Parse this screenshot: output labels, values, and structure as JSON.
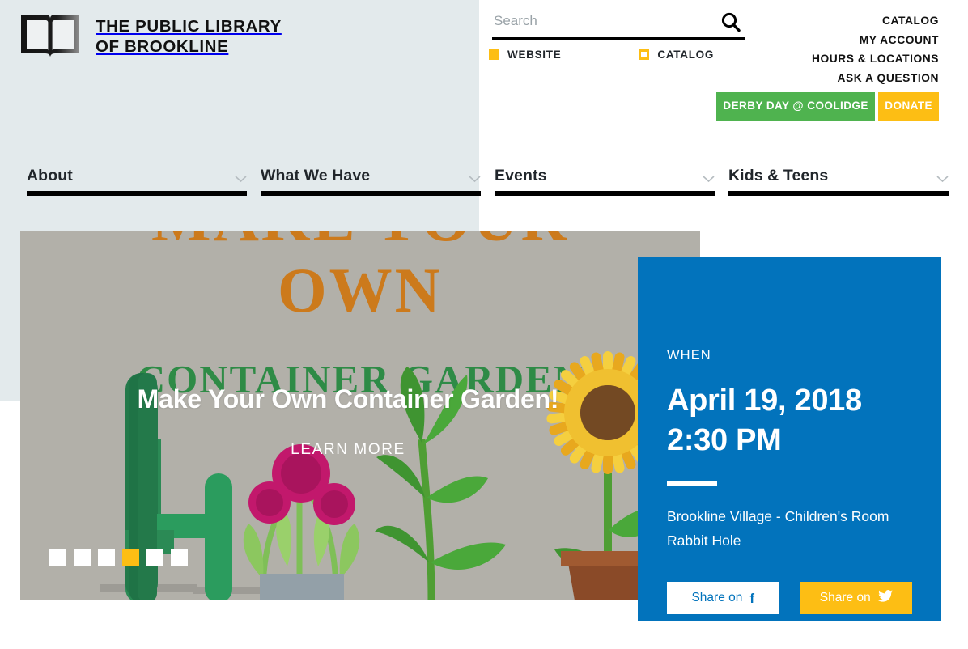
{
  "brand": {
    "name": "THE PUBLIC LIBRARY\nOF BROOKLINE",
    "logo_icon": "open-book-icon"
  },
  "search": {
    "placeholder": "Search",
    "value": "",
    "icon": "search-icon",
    "scopes": [
      {
        "label": "WEBSITE",
        "selected": true
      },
      {
        "label": "CATALOG",
        "selected": false
      }
    ]
  },
  "utility_nav": {
    "links": [
      "CATALOG",
      "MY ACCOUNT",
      "HOURS & LOCATIONS",
      "ASK A QUESTION"
    ],
    "promo": {
      "label": "DERBY DAY @ COOLIDGE",
      "color": "#4fb34f"
    },
    "donate": {
      "label": "DONATE",
      "color": "#fdbe14"
    }
  },
  "main_nav": {
    "items": [
      {
        "label": "About",
        "icon": "chevron-down-icon"
      },
      {
        "label": "What We Have",
        "icon": "chevron-down-icon"
      },
      {
        "label": "Events",
        "icon": "chevron-down-icon"
      },
      {
        "label": "Kids & Teens",
        "icon": "chevron-down-icon"
      }
    ]
  },
  "hero": {
    "poster_line1": "MAKE YOUR",
    "poster_line2": "OWN",
    "poster_line3": "CONTAINER GARDEN",
    "title": "Make Your Own Container Garden!",
    "cta": "LEARN MORE",
    "slides_total": 6,
    "active_slide": 4
  },
  "event_panel": {
    "when_label": "WHEN",
    "date": "April 19, 2018",
    "time": "2:30 PM",
    "location_line1": "Brookline Village - Children's Room",
    "location_line2": "Rabbit Hole",
    "share_facebook": "Share on",
    "share_facebook_icon": "facebook-icon",
    "share_twitter": "Share on",
    "share_twitter_icon": "twitter-icon",
    "accent_color": "#0273bc"
  }
}
